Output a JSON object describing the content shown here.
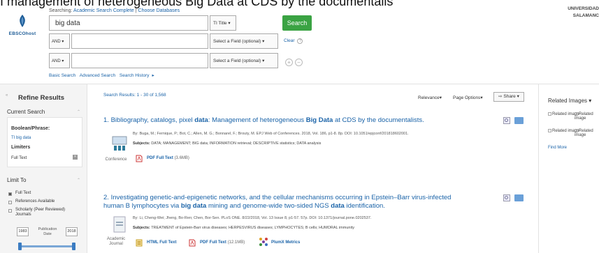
{
  "banner": {
    "title": "I management of heterogeneous Big Data at CDS by the documentalis",
    "univ_line1": "UNIVERSIDAD",
    "univ_line2": "SALAMANC"
  },
  "logo": {
    "text": "EBSCOhost"
  },
  "search": {
    "searching_label": "Searching:",
    "database": "Academic Search Complete",
    "choose": "Choose Databases",
    "query": "big data",
    "field1": "TI Title",
    "search_button": "Search",
    "bool1": "AND",
    "bool2": "AND",
    "field2": "Select a Field (optional)",
    "field3": "Select a Field (optional)",
    "clear": "Clear",
    "help": "?",
    "add": "+",
    "remove": "−",
    "links": [
      "Basic Search",
      "Advanced Search",
      "Search History"
    ]
  },
  "sidebar": {
    "refine": "Refine Results",
    "current_search": "Current Search",
    "boolean_phrase": "Boolean/Phrase:",
    "query_term": "TI big data",
    "limiters": "Limiters",
    "full_text": "Full Text",
    "limit_to": "Limit To",
    "options": [
      {
        "label": "Full Text",
        "checked": true
      },
      {
        "label": "References Available",
        "checked": false
      },
      {
        "label": "Scholarly (Peer Reviewed) Journals",
        "checked": false
      }
    ],
    "year_from": "1983",
    "year_to": "2018",
    "publication_date": "Publication Date"
  },
  "results": {
    "header": "Search Results: 1 - 30 of 1,568",
    "relevance": "Relevance",
    "page_options": "Page Options",
    "share": "Share",
    "items": [
      {
        "num": "1.",
        "title_a": "Bibliography, catalogs, pixel ",
        "title_b": "data",
        "title_c": ": Management of heterogeneous ",
        "title_d": "Big Data",
        "title_e": " at CDS by the documentalists.",
        "meta": "By: Buga, M.; Fernique, P.; Bot, C.; Allen, M. G.; Bonnarel, F.; Brouty, M. EPJ Web of Conferences. 2018, Vol. 186, p1-8. 8p. DOI: 10.1051/epjconf/201818602001.",
        "subjects_label": "Subjects:",
        "subjects": " DATA; MANAGEMENT; BIG data; INFORMATION retrieval; DESCRIPTIVE statistics; DATA analysis",
        "type": "Conference",
        "pdf": "PDF Full Text",
        "pdf_size": "(3.6MB)"
      },
      {
        "num": "2.",
        "title_line1": "Investigating genetic-and-epigenetic networks, and the cellular mechanisms occurring in Epstein–Barr virus-infected",
        "title_line2_a": "human B lymphocytes via ",
        "title_line2_b": "big data",
        "title_line2_c": " mining and genome-wide two-sided NGS ",
        "title_line2_d": "data",
        "title_line2_e": " identification.",
        "meta": "By: Li, Cheng-Wei; Jheng, Bo-Ren; Chen, Bor-Sen. PLoS ONE. 8/22/2018, Vol. 13 Issue 8, p1-57. 57p. DOI: 10.1371/journal.pone.0202537.",
        "subjects_label": "Subjects:",
        "subjects": " TREATMENT of Epstein-Barr virus diseases; HERPESVIRUS diseases; LYMPHOCYTES; B cells; HUMORAL immunity",
        "type_line1": "Academic",
        "type_line2": "Journal",
        "html": "HTML Full Text",
        "pdf": "PDF Full Text",
        "pdf_size": "(12.1MB)",
        "plumx": "PlumX Metrics"
      }
    ]
  },
  "related": {
    "header": "Related Images",
    "items": [
      "Related image",
      "Related image",
      "Related image",
      "Related image"
    ],
    "find_more": "Find More"
  },
  "colors": {
    "accent": "#1a63a8",
    "search_button": "#3aa343"
  }
}
